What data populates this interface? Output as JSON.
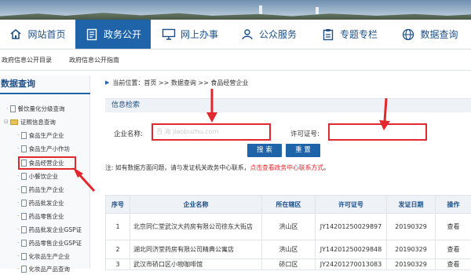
{
  "nav": {
    "items": [
      {
        "label": "网站首页",
        "icon": "home-icon"
      },
      {
        "label": "政务公开",
        "icon": "document-icon",
        "active": true
      },
      {
        "label": "网上办事",
        "icon": "monitor-icon"
      },
      {
        "label": "公众服务",
        "icon": "people-icon"
      },
      {
        "label": "专题专栏",
        "icon": "clipboard-icon"
      },
      {
        "label": "数据查询",
        "icon": "globe-icon"
      }
    ]
  },
  "subbar": {
    "items": [
      "政府信息公开目录",
      "政府信息公开指南"
    ]
  },
  "sidebar": {
    "title": "数据查询",
    "items": [
      {
        "label": "餐饮量化分级查询"
      },
      {
        "label": "证照信息查询"
      },
      {
        "label": "食品生产企业"
      },
      {
        "label": "食品生产小作坊"
      },
      {
        "label": "食品经营企业"
      },
      {
        "label": "小餐饮企业"
      },
      {
        "label": "药品生产企业"
      },
      {
        "label": "药品批发企业"
      },
      {
        "label": "药品零售企业"
      },
      {
        "label": "药品批发企业GSP证"
      },
      {
        "label": "药品零售企业GSP证"
      },
      {
        "label": "化妆品生产企业"
      },
      {
        "label": "化妆品产品查询"
      }
    ]
  },
  "breadcrumb": {
    "text": "当前位置：首页 >> 数据查询 >> 食品经营企业"
  },
  "search": {
    "heading": "信息检索",
    "name_label": "企业名称:",
    "name_value": "",
    "license_label": "许可证号:",
    "license_value": "",
    "watermark": "百  海      jiaobuzhu.com",
    "search_button": "搜 索",
    "reset_button": "重 置",
    "note_prefix": "注: 如有数据方面问题，请与发证机关政务中心联系，",
    "note_link": "点击查看政务中心联系方式",
    "note_suffix": "。"
  },
  "table": {
    "headers": [
      "序号",
      "企业名称",
      "所在辖区",
      "许可证号",
      "发证日期",
      "操作"
    ],
    "rows": [
      {
        "no": "1",
        "name": "北京同仁堂武汉大药房有限公司徐东大街店",
        "district": "洪山区",
        "license": "JY14201250029897",
        "date": "20190329",
        "action": "查看"
      },
      {
        "no": "2",
        "name": "湖北同济堂药房有限公司精典公寓店",
        "district": "洪山区",
        "license": "JY14201250029848",
        "date": "20190329",
        "action": "查看"
      },
      {
        "no": "3",
        "name": "武汉市硚口区小物咖啡馆",
        "district": "硚口区",
        "license": "JY24201270013083",
        "date": "20190329",
        "action": "查看"
      }
    ]
  },
  "colors": {
    "primary": "#1f63a8",
    "highlight": "#e0282e",
    "header_bg": "#eef2f7"
  }
}
